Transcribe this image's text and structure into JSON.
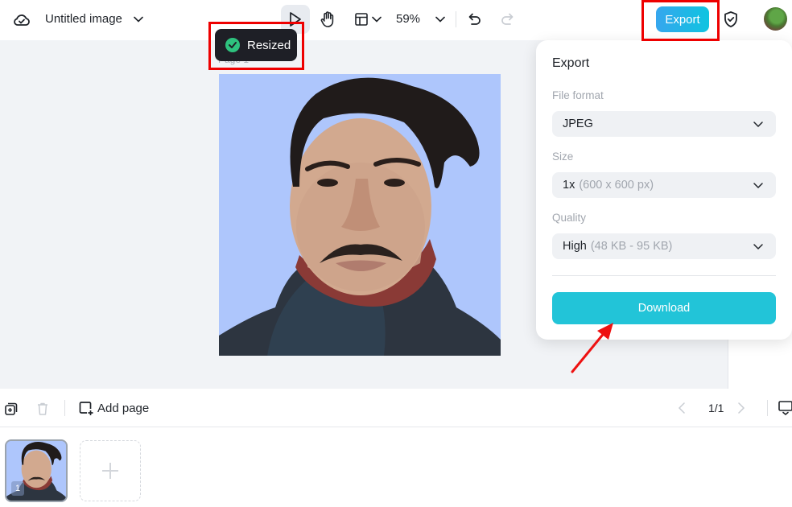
{
  "header": {
    "doc_title": "Untitled image",
    "zoom_level": "59%",
    "export_label": "Export",
    "icons": {
      "cloud": "cloud-check-icon",
      "select": "pointer-icon",
      "hand": "hand-icon",
      "layout": "layout-icon",
      "undo": "undo-icon",
      "redo": "redo-icon",
      "shield": "shield-check-icon"
    }
  },
  "toast": {
    "message": "Resized",
    "status_color": "#2ec27e"
  },
  "canvas": {
    "page_label": "Page 1",
    "background_color": "#aec6fc"
  },
  "export_panel": {
    "title": "Export",
    "file_format": {
      "label": "File format",
      "value": "JPEG"
    },
    "size": {
      "label": "Size",
      "value": "1x",
      "detail": "(600 x 600 px)"
    },
    "quality": {
      "label": "Quality",
      "value": "High",
      "detail": "(48 KB - 95 KB)"
    },
    "download_label": "Download",
    "accent_color": "#22c4d8"
  },
  "bottom_bar": {
    "add_page_label": "Add page",
    "page_indicator": "1/1"
  },
  "thumbnails": [
    {
      "number": "1",
      "selected": true
    }
  ],
  "annotations": {
    "highlight_color": "#ee0000"
  }
}
